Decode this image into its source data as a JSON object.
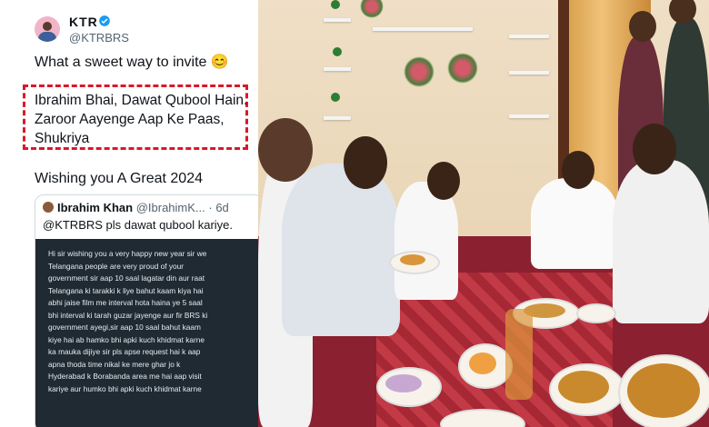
{
  "tweet": {
    "author_name": "KTR",
    "handle": "@KTRBRS",
    "line1": "What a sweet way to invite 😊",
    "highlighted_quote": "Ibrahim Bhai, Dawat Qubool Hain. Zaroor Aayenge Aap Ke Paas, Shukriya",
    "wish_line": "Wishing you A Great 2024"
  },
  "quoted_tweet": {
    "author_name": "Ibrahim Khan",
    "handle": "@IbrahimK...",
    "time": "· 6d",
    "text": "@KTRBRS pls dawat qubool kariye.",
    "image_text": "Hi sir wishing you a very happy new year sir we\nTelangana people are very proud of your\ngovernment sir aap 10 saal lagatar din aur raat\nTelangana ki tarakki k liye bahut kaam kiya hai\nabhi jaise film me interval hota haina ye 5 saal\nbhi interval ki tarah guzar jayenge aur fir BRS ki\ngovernment ayegi,sir aap 10 saal bahut kaam\nkiye hai ab hamko bhi apki kuch khidmat karne\nka mauka dijiye sir pls apse request hai k aap\napna thoda time nikal ke mere ghar jo k\nHyderabad k Borabanda area me hai aap visit\nkariye aur humko bhi apki kuch khidmat karne"
  },
  "colors": {
    "highlight_border": "#d9182a",
    "verified": "#1d9bf0",
    "dark_panel": "#1f2a33"
  },
  "icons": [
    "verified-badge-icon",
    "avatar"
  ]
}
